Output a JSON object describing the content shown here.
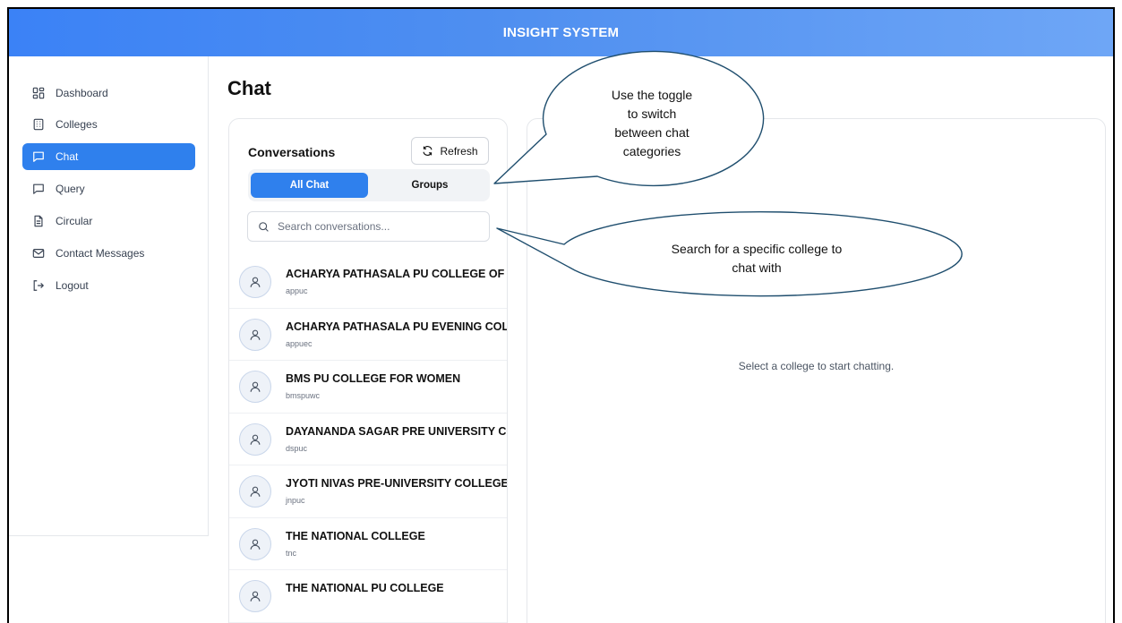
{
  "app": {
    "title": "INSIGHT SYSTEM"
  },
  "sidebar": {
    "items": [
      {
        "label": "Dashboard",
        "icon": "dashboard-icon"
      },
      {
        "label": "Colleges",
        "icon": "building-icon"
      },
      {
        "label": "Chat",
        "icon": "chat-icon",
        "active": true
      },
      {
        "label": "Query",
        "icon": "query-icon"
      },
      {
        "label": "Circular",
        "icon": "document-icon"
      },
      {
        "label": "Contact Messages",
        "icon": "mail-icon"
      },
      {
        "label": "Logout",
        "icon": "logout-icon"
      }
    ]
  },
  "page": {
    "title": "Chat"
  },
  "conversations": {
    "title": "Conversations",
    "refresh_label": "Refresh",
    "tabs": {
      "all": "All Chat",
      "groups": "Groups"
    },
    "search_placeholder": "Search conversations...",
    "items": [
      {
        "name": "ACHARYA PATHASALA PU COLLEGE OF",
        "code": "appuc"
      },
      {
        "name": "ACHARYA PATHASALA PU EVENING COLLEGE",
        "code": "appuec"
      },
      {
        "name": "BMS PU COLLEGE FOR WOMEN",
        "code": "bmspuwc"
      },
      {
        "name": "DAYANANDA SAGAR PRE UNIVERSITY COLLEGE",
        "code": "dspuc"
      },
      {
        "name": "JYOTI NIVAS PRE-UNIVERSITY COLLEGE",
        "code": "jnpuc"
      },
      {
        "name": "THE NATIONAL COLLEGE",
        "code": "tnc"
      },
      {
        "name": "THE NATIONAL PU COLLEGE",
        "code": ""
      }
    ]
  },
  "chat": {
    "empty_text": "Select a college to start chatting."
  },
  "callouts": {
    "toggle": {
      "lines": [
        "Use the toggle",
        "to switch",
        "between chat",
        "categories"
      ]
    },
    "search": {
      "lines": [
        "Search for a specific college to",
        "chat with"
      ]
    }
  },
  "colors": {
    "accent": "#2f80ed",
    "header_start": "#3b82f6",
    "header_end": "#6ea6f6",
    "callout_stroke": "#1f4e6e"
  }
}
